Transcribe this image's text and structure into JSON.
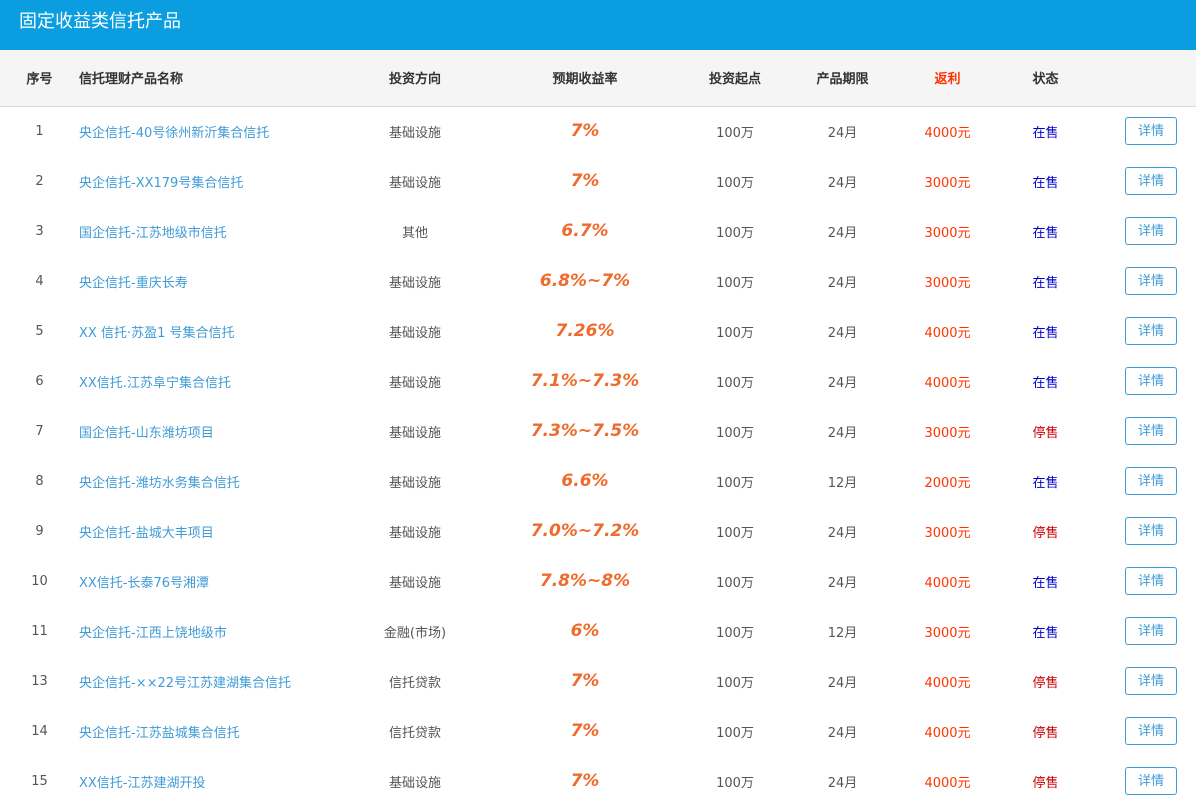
{
  "page": {
    "title": "固定收益类信托产品"
  },
  "columns": {
    "no": "序号",
    "name": "信托理财产品名称",
    "direction": "投资方向",
    "rate": "预期收益率",
    "start": "投资起点",
    "term": "产品期限",
    "rebate": "返利",
    "status": "状态"
  },
  "colors": {
    "header_bg": "#0a9ee0",
    "link": "#3f9bd6",
    "rate": "#ef6a2b",
    "rebate": "#ff3300",
    "on_sale": "#0000cc",
    "stopped": "#cc0000"
  },
  "rows": [
    {
      "no": "1",
      "name": "央企信托-40号徐州新沂集合信托",
      "direction": "基础设施",
      "rate": "7%",
      "start": "100万",
      "term": "24月",
      "rebate": "4000元",
      "status": "在售",
      "action": "详情"
    },
    {
      "no": "2",
      "name": "央企信托-XX179号集合信托",
      "direction": "基础设施",
      "rate": "7%",
      "start": "100万",
      "term": "24月",
      "rebate": "3000元",
      "status": "在售",
      "action": "详情"
    },
    {
      "no": "3",
      "name": "国企信托-江苏地级市信托",
      "direction": "其他",
      "rate": "6.7%",
      "start": "100万",
      "term": "24月",
      "rebate": "3000元",
      "status": "在售",
      "action": "详情"
    },
    {
      "no": "4",
      "name": "央企信托-重庆长寿",
      "direction": "基础设施",
      "rate": "6.8%~7%",
      "start": "100万",
      "term": "24月",
      "rebate": "3000元",
      "status": "在售",
      "action": "详情"
    },
    {
      "no": "5",
      "name": "XX 信托·苏盈1 号集合信托",
      "direction": "基础设施",
      "rate": "7.26%",
      "start": "100万",
      "term": "24月",
      "rebate": "4000元",
      "status": "在售",
      "action": "详情"
    },
    {
      "no": "6",
      "name": "XX信托.江苏阜宁集合信托",
      "direction": "基础设施",
      "rate": "7.1%~7.3%",
      "start": "100万",
      "term": "24月",
      "rebate": "4000元",
      "status": "在售",
      "action": "详情"
    },
    {
      "no": "7",
      "name": "国企信托-山东潍坊项目",
      "direction": "基础设施",
      "rate": "7.3%~7.5%",
      "start": "100万",
      "term": "24月",
      "rebate": "3000元",
      "status": "停售",
      "action": "详情"
    },
    {
      "no": "8",
      "name": "央企信托-潍坊水务集合信托",
      "direction": "基础设施",
      "rate": "6.6%",
      "start": "100万",
      "term": "12月",
      "rebate": "2000元",
      "status": "在售",
      "action": "详情"
    },
    {
      "no": "9",
      "name": "央企信托-盐城大丰项目",
      "direction": "基础设施",
      "rate": "7.0%~7.2%",
      "start": "100万",
      "term": "24月",
      "rebate": "3000元",
      "status": "停售",
      "action": "详情"
    },
    {
      "no": "10",
      "name": "XX信托-长泰76号湘潭",
      "direction": "基础设施",
      "rate": "7.8%~8%",
      "start": "100万",
      "term": "24月",
      "rebate": "4000元",
      "status": "在售",
      "action": "详情"
    },
    {
      "no": "11",
      "name": "央企信托-江西上饶地级市",
      "direction": "金融(市场)",
      "rate": "6%",
      "start": "100万",
      "term": "12月",
      "rebate": "3000元",
      "status": "在售",
      "action": "详情"
    },
    {
      "no": "13",
      "name": "央企信托-××22号江苏建湖集合信托",
      "direction": "信托贷款",
      "rate": "7%",
      "start": "100万",
      "term": "24月",
      "rebate": "4000元",
      "status": "停售",
      "action": "详情"
    },
    {
      "no": "14",
      "name": "央企信托-江苏盐城集合信托",
      "direction": "信托贷款",
      "rate": "7%",
      "start": "100万",
      "term": "24月",
      "rebate": "4000元",
      "status": "停售",
      "action": "详情"
    },
    {
      "no": "15",
      "name": "XX信托-江苏建湖开投",
      "direction": "基础设施",
      "rate": "7%",
      "start": "100万",
      "term": "24月",
      "rebate": "4000元",
      "status": "停售",
      "action": "详情"
    }
  ]
}
